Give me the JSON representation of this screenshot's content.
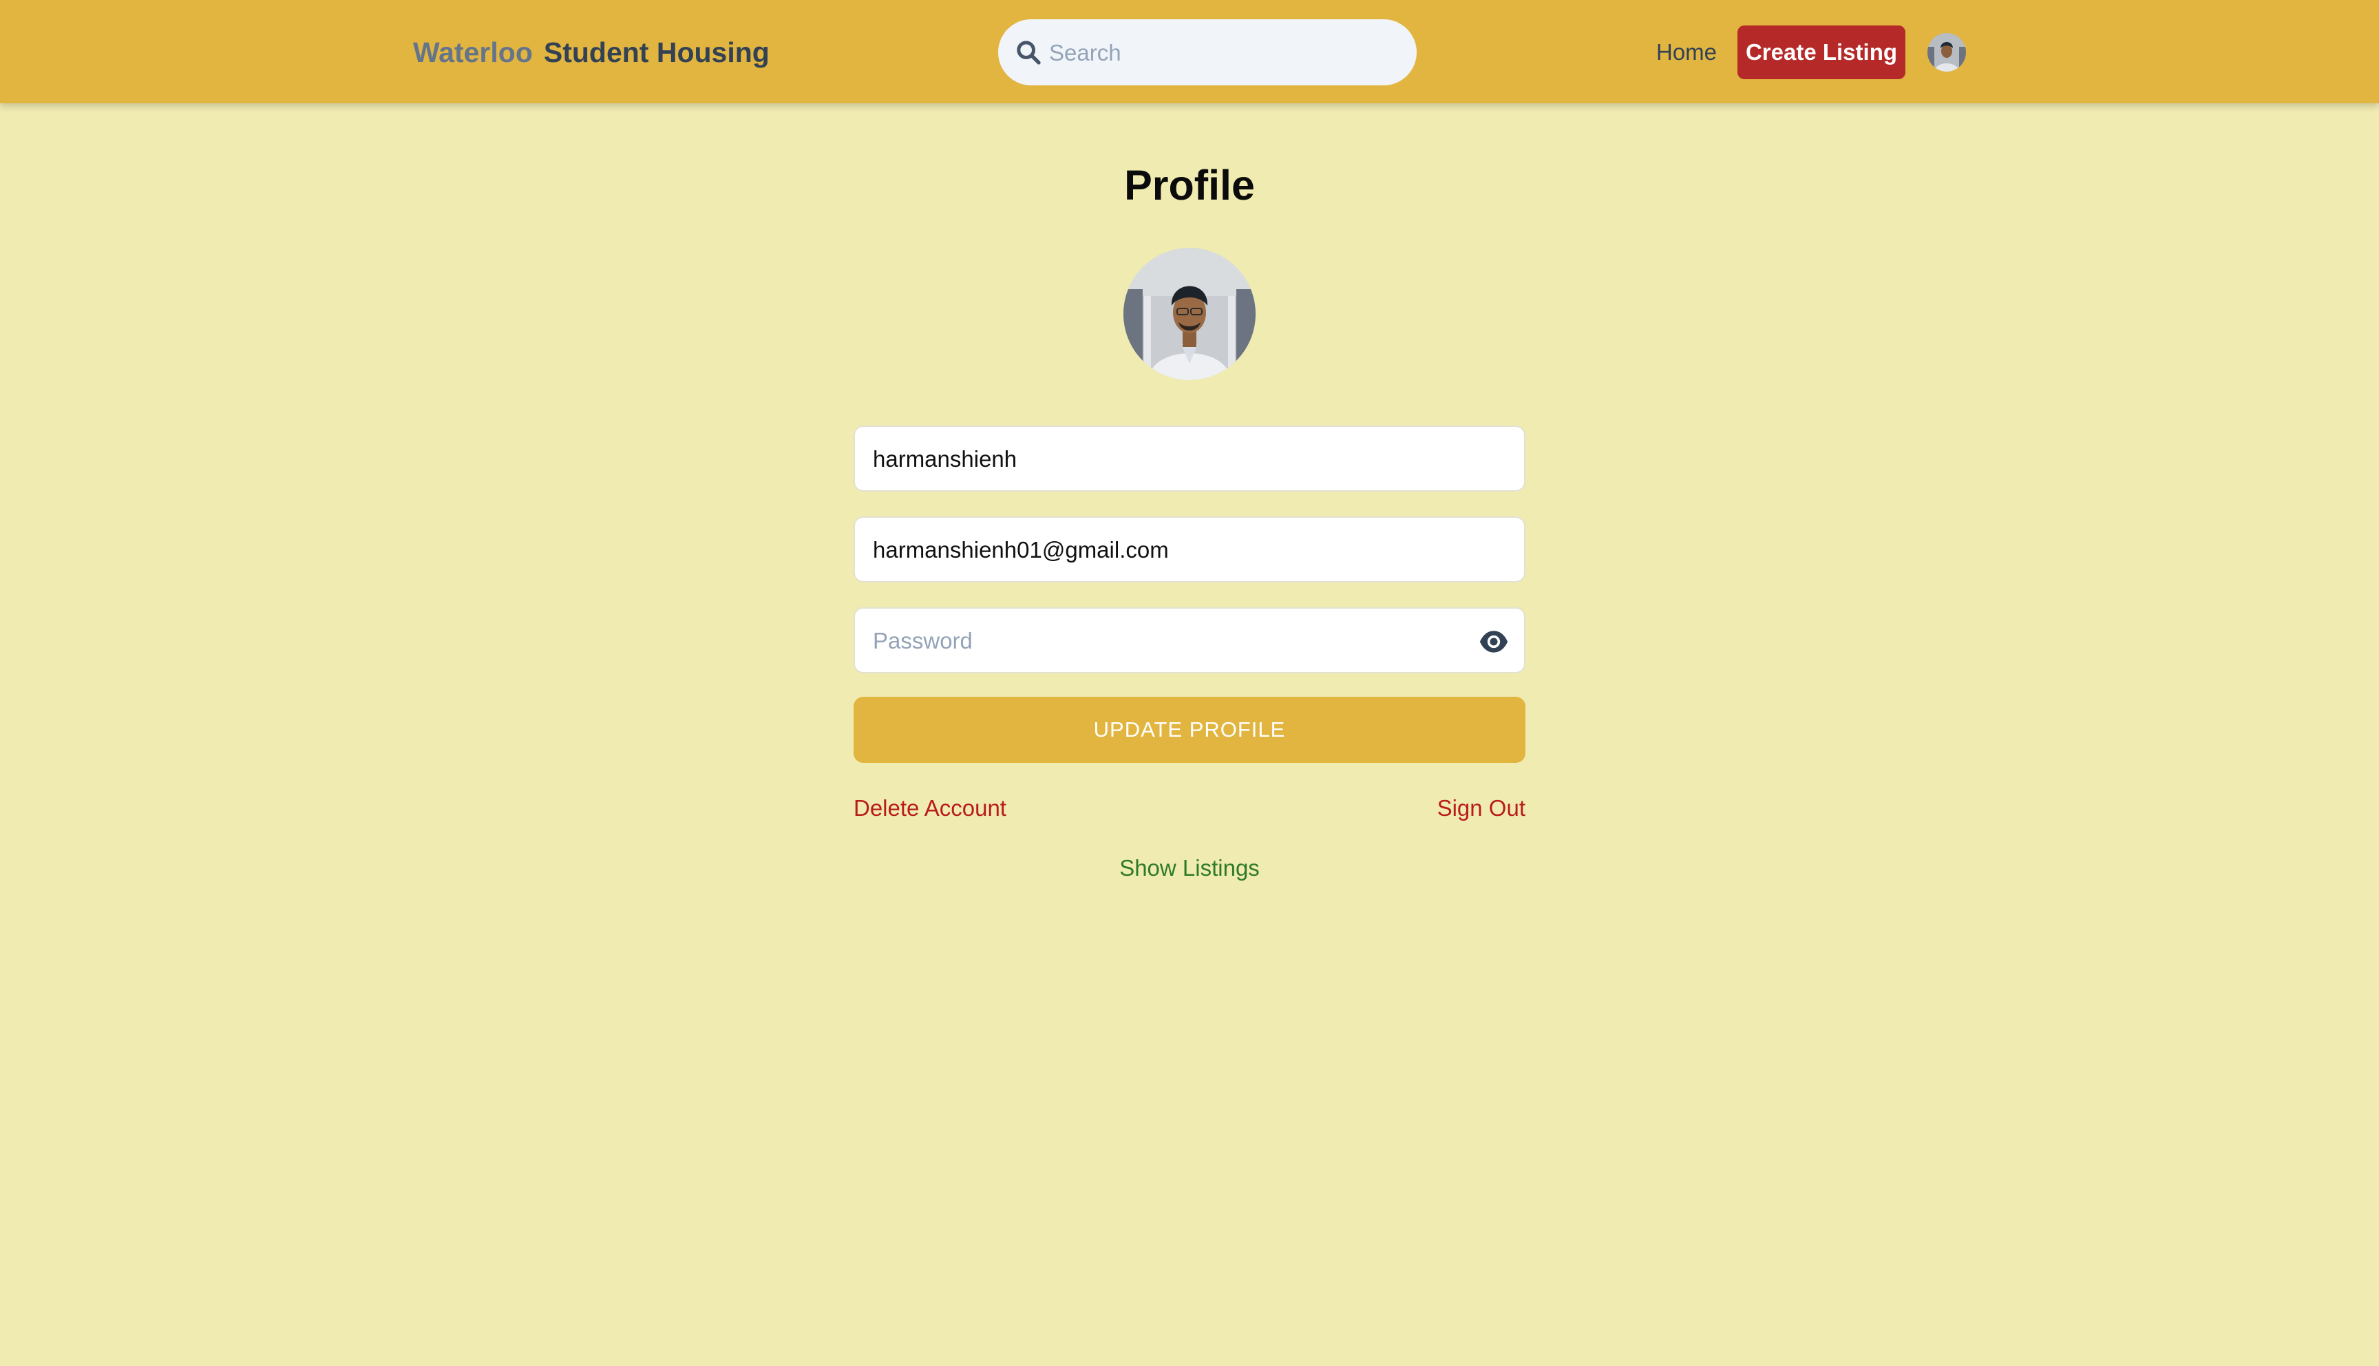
{
  "header": {
    "brand_first": "Waterloo",
    "brand_second": "Student Housing",
    "search_placeholder": "Search",
    "search_icon": "search-icon",
    "nav_home": "Home",
    "create_listing": "Create Listing",
    "avatar_icon": "user-avatar"
  },
  "profile": {
    "title": "Profile",
    "avatar_icon": "profile-photo",
    "username_value": "harmanshienh",
    "email_value": "harmanshienh01@gmail.com",
    "password_placeholder": "Password",
    "password_toggle_icon": "eye-icon",
    "update_button": "UPDATE PROFILE",
    "delete_account": "Delete Account",
    "sign_out": "Sign Out",
    "show_listings": "Show Listings"
  },
  "colors": {
    "page_background": "#f0ebb1",
    "header_background": "#e1b53f",
    "create_button": "#b52a28",
    "update_button": "#e1b53f",
    "danger_link": "#b91c1c",
    "success_link": "#2f7a28"
  }
}
